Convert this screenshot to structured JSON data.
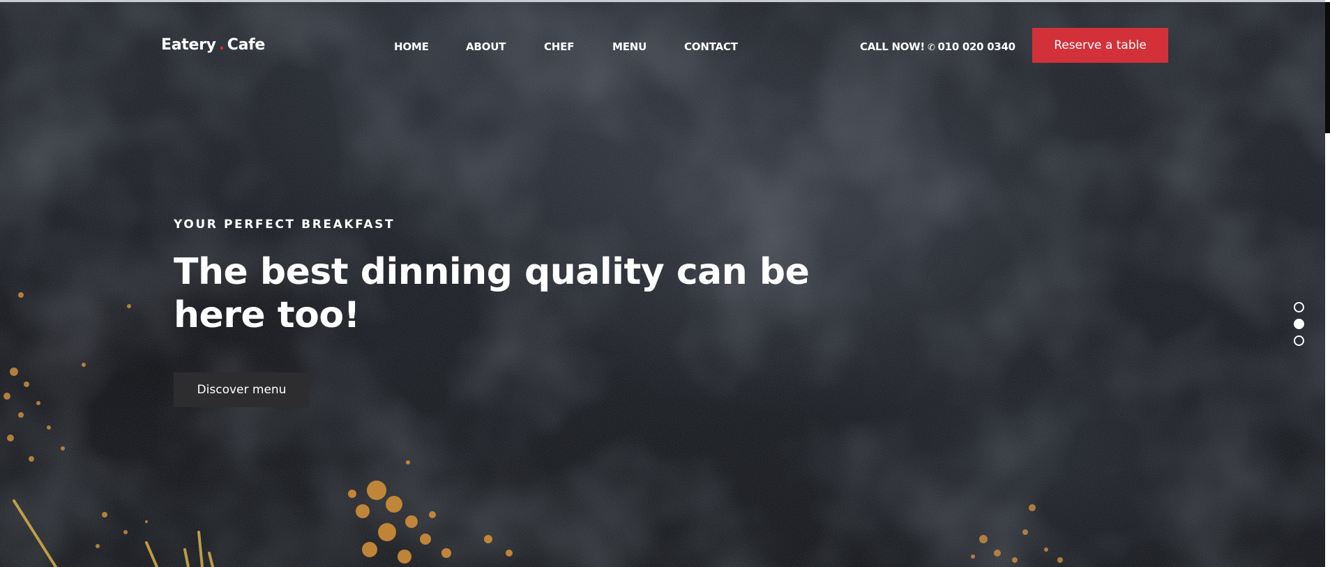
{
  "header": {
    "logo": {
      "left": "Eatery",
      "dot": ".",
      "right": "Cafe"
    },
    "nav": [
      {
        "label": "HOME"
      },
      {
        "label": "ABOUT"
      },
      {
        "label": "CHEF"
      },
      {
        "label": "MENU"
      },
      {
        "label": "CONTACT"
      }
    ],
    "call": {
      "prefix": "CALL NOW!",
      "icon": "phone-icon",
      "number": "010 020 0340"
    },
    "reserve_label": "Reserve a table"
  },
  "hero": {
    "eyebrow": "YOUR PERFECT BREAKFAST",
    "headline_line1": "The best dinning quality can be",
    "headline_line2": "here too!",
    "cta_label": "Discover menu"
  },
  "slider": {
    "slide_count": 3,
    "active_index": 1
  },
  "colors": {
    "accent": "#d3313a",
    "background": "#1c1f25",
    "text": "#ffffff",
    "secondary_button": "#2d2d2f"
  }
}
